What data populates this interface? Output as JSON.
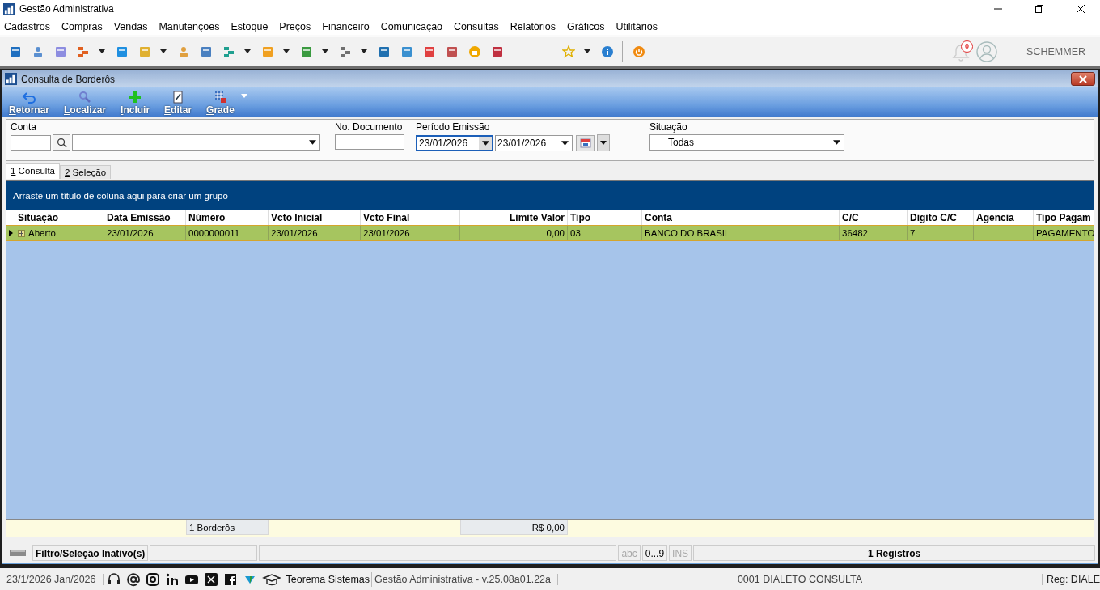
{
  "window": {
    "title": "Gestão Administrativa"
  },
  "menu": [
    "Cadastros",
    "Compras",
    "Vendas",
    "Manutenções",
    "Estoque",
    "Preços",
    "Financeiro",
    "Comunicação",
    "Consultas",
    "Relatórios",
    "Gráficos",
    "Utilitários"
  ],
  "notifications": {
    "count": "0"
  },
  "user": {
    "name": "SCHEMMER"
  },
  "child_window": {
    "title": "Consulta de Borderôs"
  },
  "toolbar": [
    {
      "label": "Retornar",
      "kind": "back"
    },
    {
      "label": "Localizar",
      "kind": "search"
    },
    {
      "label": "Incluir",
      "kind": "add"
    },
    {
      "label": "Editar",
      "kind": "edit"
    },
    {
      "label": "Grade",
      "kind": "grid"
    }
  ],
  "filters": {
    "conta_label": "Conta",
    "documento_label": "No. Documento",
    "periodo_label": "Período Emissão",
    "date_from": "23/01/2026",
    "date_to": "23/01/2026",
    "situacao_label": "Situação",
    "situacao_value": "Todas"
  },
  "tabs": [
    {
      "label": "1 Consulta",
      "selected": true
    },
    {
      "label": "2 Seleção",
      "selected": false
    }
  ],
  "group_panel": "Arraste um título de coluna aqui para criar um grupo",
  "table": {
    "columns": [
      {
        "label": "Situação",
        "kind": "text"
      },
      {
        "label": "Data Emissão",
        "kind": "text"
      },
      {
        "label": "Número",
        "kind": "text",
        "summary": "1 Borderôs"
      },
      {
        "label": "Vcto Inicial",
        "kind": "text"
      },
      {
        "label": "Vcto Final",
        "kind": "text"
      },
      {
        "label": "Limite Valor",
        "kind": "number",
        "summary": "R$ 0,00"
      },
      {
        "label": "Tipo",
        "kind": "text"
      },
      {
        "label": "Conta",
        "kind": "text"
      },
      {
        "label": "C/C",
        "kind": "text"
      },
      {
        "label": "Digito C/C",
        "kind": "text"
      },
      {
        "label": "Agencia",
        "kind": "text"
      },
      {
        "label": "Tipo Pagam",
        "kind": "text"
      }
    ],
    "rows": [
      {
        "selected": true,
        "cells": [
          "Aberto",
          "23/01/2026",
          "0000000011",
          "23/01/2026",
          "23/01/2026",
          "0,00",
          "03",
          "BANCO DO BRASIL",
          "36482",
          "7",
          null,
          "PAGAMENTO"
        ]
      }
    ]
  },
  "status_bar": {
    "filter": "Filtro/Seleção Inativo(s)",
    "indicators": [
      {
        "label": "abc",
        "on": false
      },
      {
        "label": "0...9",
        "on": true
      },
      {
        "label": "INS",
        "on": false
      }
    ],
    "records": "1 Registros"
  },
  "bottom_bar": {
    "date": "23/1/2026 Jan/2026",
    "link": "Teorema Sistemas",
    "version": "Gestão Administrativa - v.25.08a01.22a",
    "company": "0001 DIALETO CONSULTA",
    "reg": "Reg: DIALE"
  }
}
